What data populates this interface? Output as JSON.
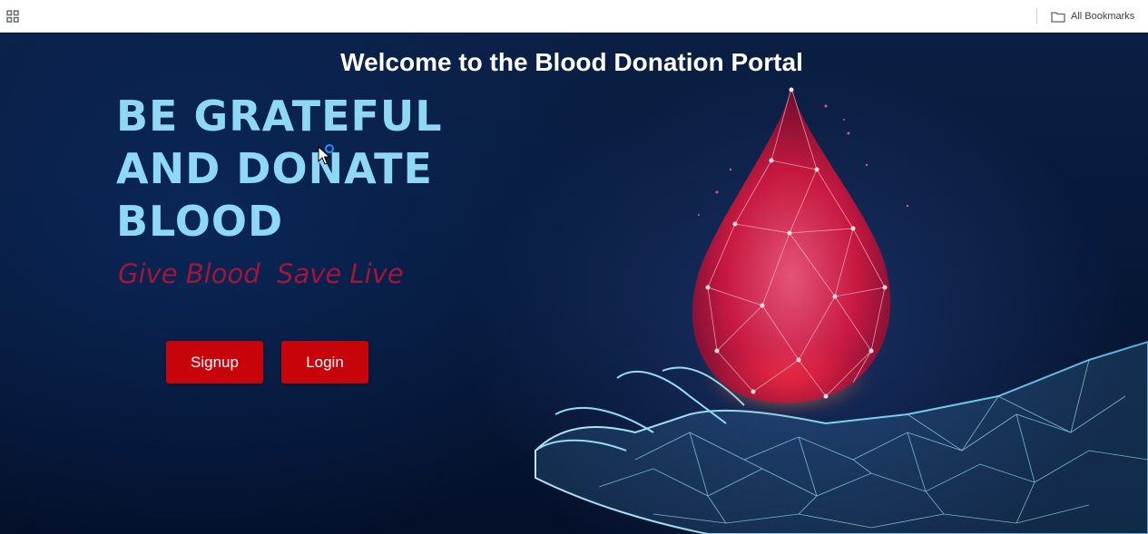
{
  "browser": {
    "apps_icon": "apps-grid-icon",
    "bookmarks_label": "All Bookmarks",
    "bookmarks_icon": "folder-icon"
  },
  "page": {
    "title": "Welcome to the Blood Donation Portal",
    "headline_lines": [
      "BE GRATEFUL",
      "AND DONATE",
      "BLOOD"
    ],
    "tagline": "Give Blood  Save Live",
    "buttons": {
      "signup": "Signup",
      "login": "Login"
    },
    "hero_image": "blood-drop-on-hand-illustration"
  },
  "colors": {
    "background": "#0a1a3c",
    "headline": "#8fd8f5",
    "tagline": "#a3153a",
    "button": "#c8040b",
    "title": "#ffffff"
  }
}
